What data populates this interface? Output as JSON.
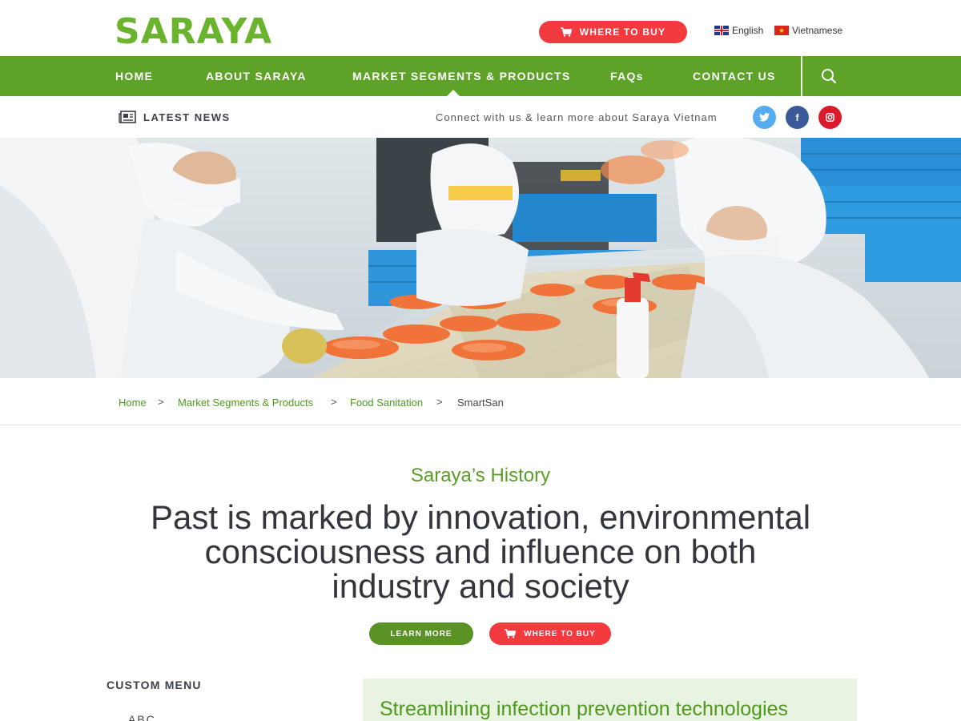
{
  "brand": {
    "logo_text": "SARAYA",
    "accent": "#5fa228",
    "red": "#f23a3f"
  },
  "topbar": {
    "where_to_buy": "WHERE TO BUY",
    "languages": [
      {
        "label": "English",
        "flag": "uk-flag-icon"
      },
      {
        "label": "Vietnamese",
        "flag": "vietnam-flag-icon"
      }
    ]
  },
  "nav": {
    "items": [
      {
        "label": "HOME"
      },
      {
        "label": "ABOUT SARAYA"
      },
      {
        "label": "MARKET SEGMENTS & PRODUCTS",
        "active": true
      },
      {
        "label": "FAQs"
      },
      {
        "label": "CONTACT US"
      }
    ],
    "search_icon": "search-icon"
  },
  "subbar": {
    "latest_news": "LATEST NEWS",
    "connect_text": "Connect with us & learn more about Saraya Vietnam",
    "social": [
      {
        "name": "twitter-icon",
        "glyph": "t",
        "color": "#55acee"
      },
      {
        "name": "facebook-icon",
        "glyph": "f",
        "color": "#3b5998"
      },
      {
        "name": "instagram-icon",
        "glyph": "◘",
        "color": "#d91a2a"
      }
    ]
  },
  "breadcrumb": {
    "items": [
      {
        "label": "Home"
      },
      {
        "label": "Market Segments & Products"
      },
      {
        "label": "Food Sanitation"
      },
      {
        "label": "SmartSan"
      }
    ],
    "separator": ">"
  },
  "intro": {
    "eyebrow": "Saraya’s History",
    "headline_lines": [
      "Past is marked by innovation, environmental",
      "consciousness and influence on both",
      "industry and society"
    ],
    "learn_more": "LEARN MORE",
    "where_to_buy": "WHERE TO BUY"
  },
  "sidebar": {
    "title": "CUSTOM MENU",
    "first_item": "ABC"
  },
  "content": {
    "panel_title": "Streamlining infection prevention technologies"
  }
}
